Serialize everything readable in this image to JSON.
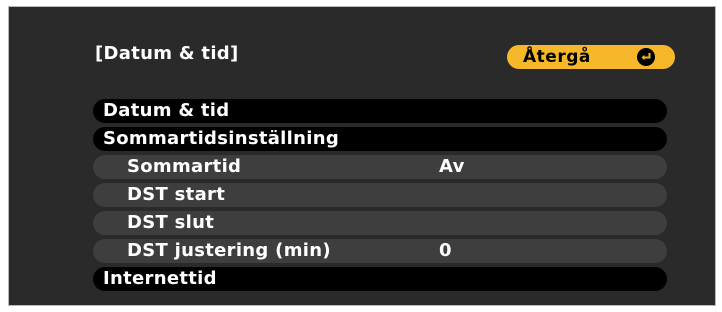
{
  "title": "[Datum & tid]",
  "back_button": {
    "label": "Återgå",
    "icon": "enter-icon"
  },
  "menu": [
    {
      "label": "Datum & tid",
      "value": "",
      "level": "main"
    },
    {
      "label": "Sommartidsinställning",
      "value": "",
      "level": "main"
    },
    {
      "label": "Sommartid",
      "value": "Av",
      "level": "sub"
    },
    {
      "label": "DST start",
      "value": "",
      "level": "sub"
    },
    {
      "label": "DST slut",
      "value": "",
      "level": "sub"
    },
    {
      "label": "DST justering (min)",
      "value": "0",
      "level": "sub"
    },
    {
      "label": "Internettid",
      "value": "",
      "level": "main"
    }
  ],
  "colors": {
    "background": "#2a2a2a",
    "button": "#f7b72a",
    "main_row": "#000000",
    "sub_row": "#3e3e3e",
    "text": "#ffffff"
  }
}
